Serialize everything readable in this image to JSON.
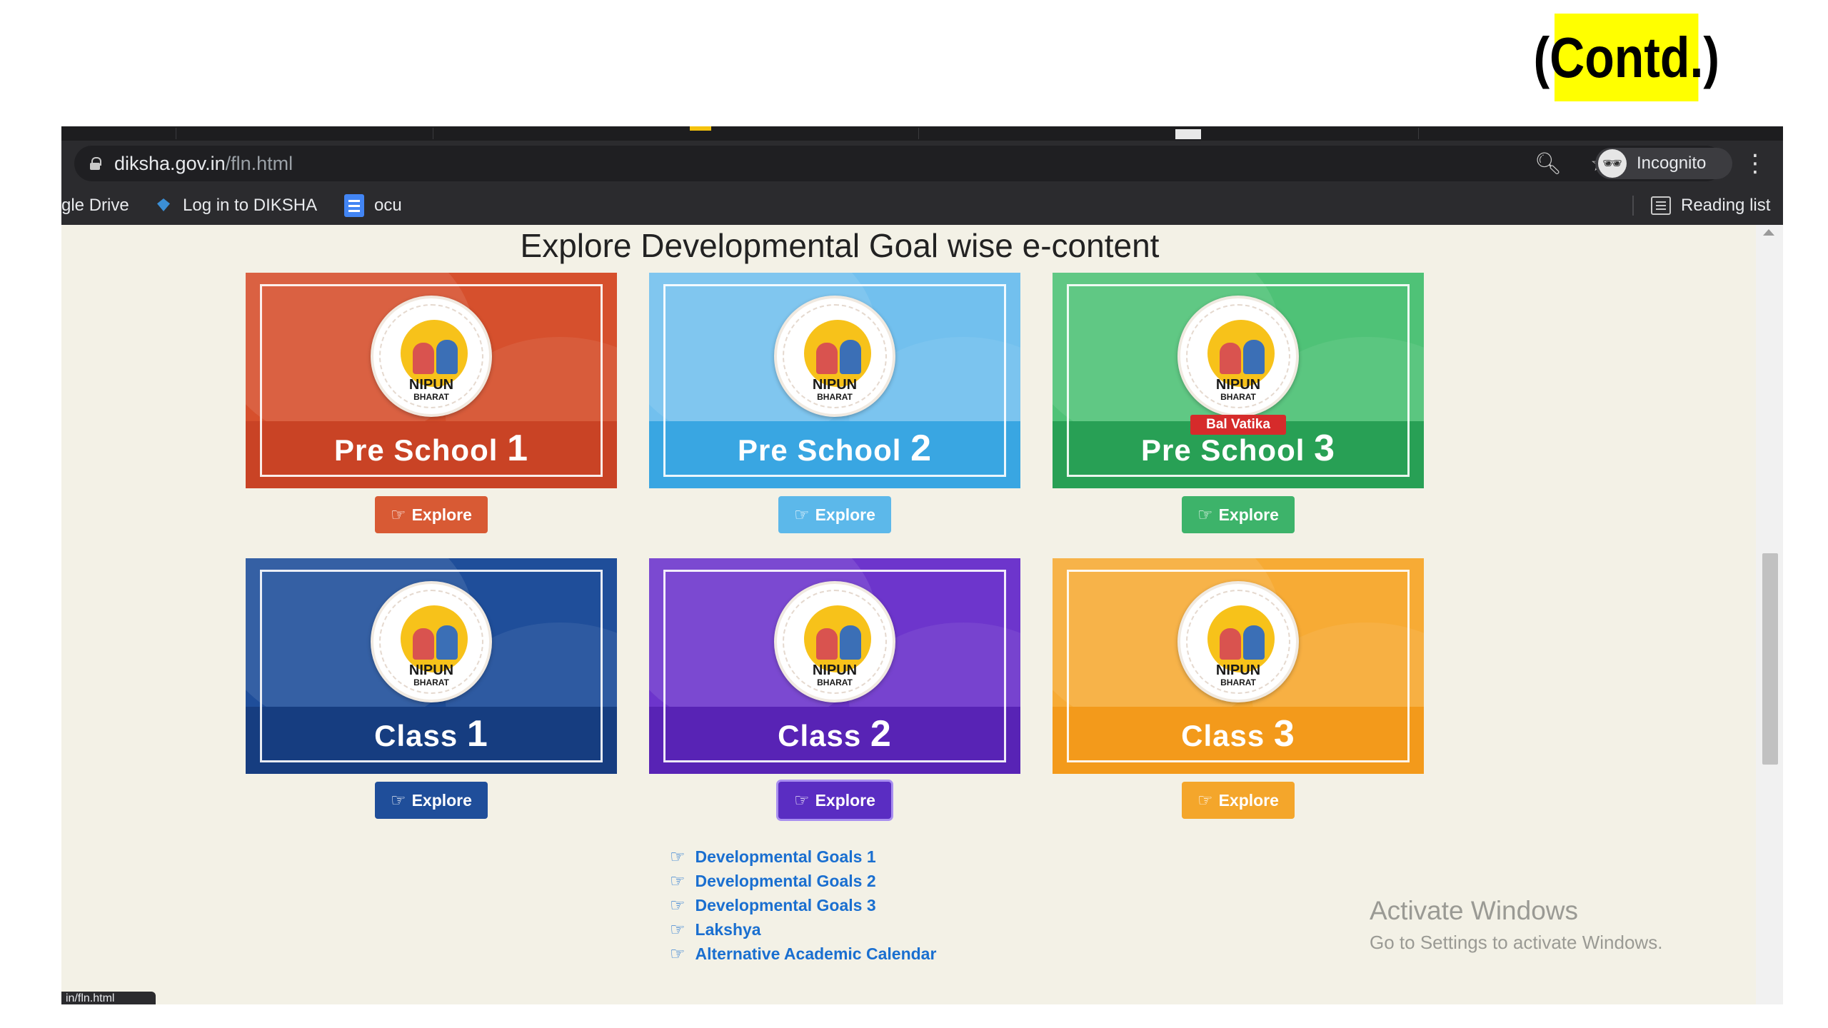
{
  "slide": {
    "contd_label": "(Contd.)"
  },
  "browser": {
    "url_host": "diksha.gov.in",
    "url_path": "/fln.html",
    "zoom_icon": "magnifier-icon",
    "star_icon": "star-icon",
    "profile_label": "Incognito",
    "menu_icon": "kebab-menu-icon"
  },
  "bookmarks": {
    "items": [
      {
        "label": "gle Drive",
        "icon": "drive-icon"
      },
      {
        "label": "Log in to DIKSHA",
        "icon": "diksha-icon"
      },
      {
        "label": "ocu",
        "icon": "docs-icon"
      }
    ],
    "reading_list": "Reading list"
  },
  "page": {
    "title": "Explore Developmental Goal wise e-content",
    "cards": [
      {
        "label": "Pre School",
        "num": "1",
        "color": "#d6502d",
        "band": "#c94325",
        "btn": "#d85a34",
        "logo": "NIPUN",
        "logo_sub": "BHARAT",
        "button": "Explore"
      },
      {
        "label": "Pre School",
        "num": "2",
        "color": "#72c0ee",
        "band": "#39a6e2",
        "btn": "#5cb8ea",
        "logo": "NIPUN",
        "logo_sub": "BHARAT",
        "button": "Explore"
      },
      {
        "label": "Pre School",
        "num": "3",
        "color": "#4fc277",
        "band": "#28a055",
        "btn": "#3db36a",
        "logo": "NIPUN",
        "logo_sub": "BHARAT",
        "badge": "Bal Vatika",
        "button": "Explore"
      },
      {
        "label": "Class",
        "num": "1",
        "color": "#1f4e9a",
        "band": "#163d80",
        "btn": "#1f4e9a",
        "logo": "NIPUN",
        "logo_sub": "BHARAT",
        "button": "Explore"
      },
      {
        "label": "Class",
        "num": "2",
        "color": "#6d35cc",
        "band": "#5823b5",
        "btn": "#5a2dc2",
        "logo": "NIPUN",
        "logo_sub": "BHARAT",
        "button": "Explore"
      },
      {
        "label": "Class",
        "num": "3",
        "color": "#f7ab35",
        "band": "#f39a1b",
        "btn": "#f4a62b",
        "logo": "NIPUN",
        "logo_sub": "BHARAT",
        "button": "Explore"
      }
    ],
    "links": [
      "Developmental Goals 1",
      "Developmental Goals 2",
      "Developmental Goals 3",
      "Lakshya",
      "Alternative Academic Calendar"
    ]
  },
  "watermark": {
    "title": "Activate Windows",
    "subtitle": "Go to Settings to activate Windows."
  },
  "status": {
    "url_preview": "in/fln.html"
  }
}
